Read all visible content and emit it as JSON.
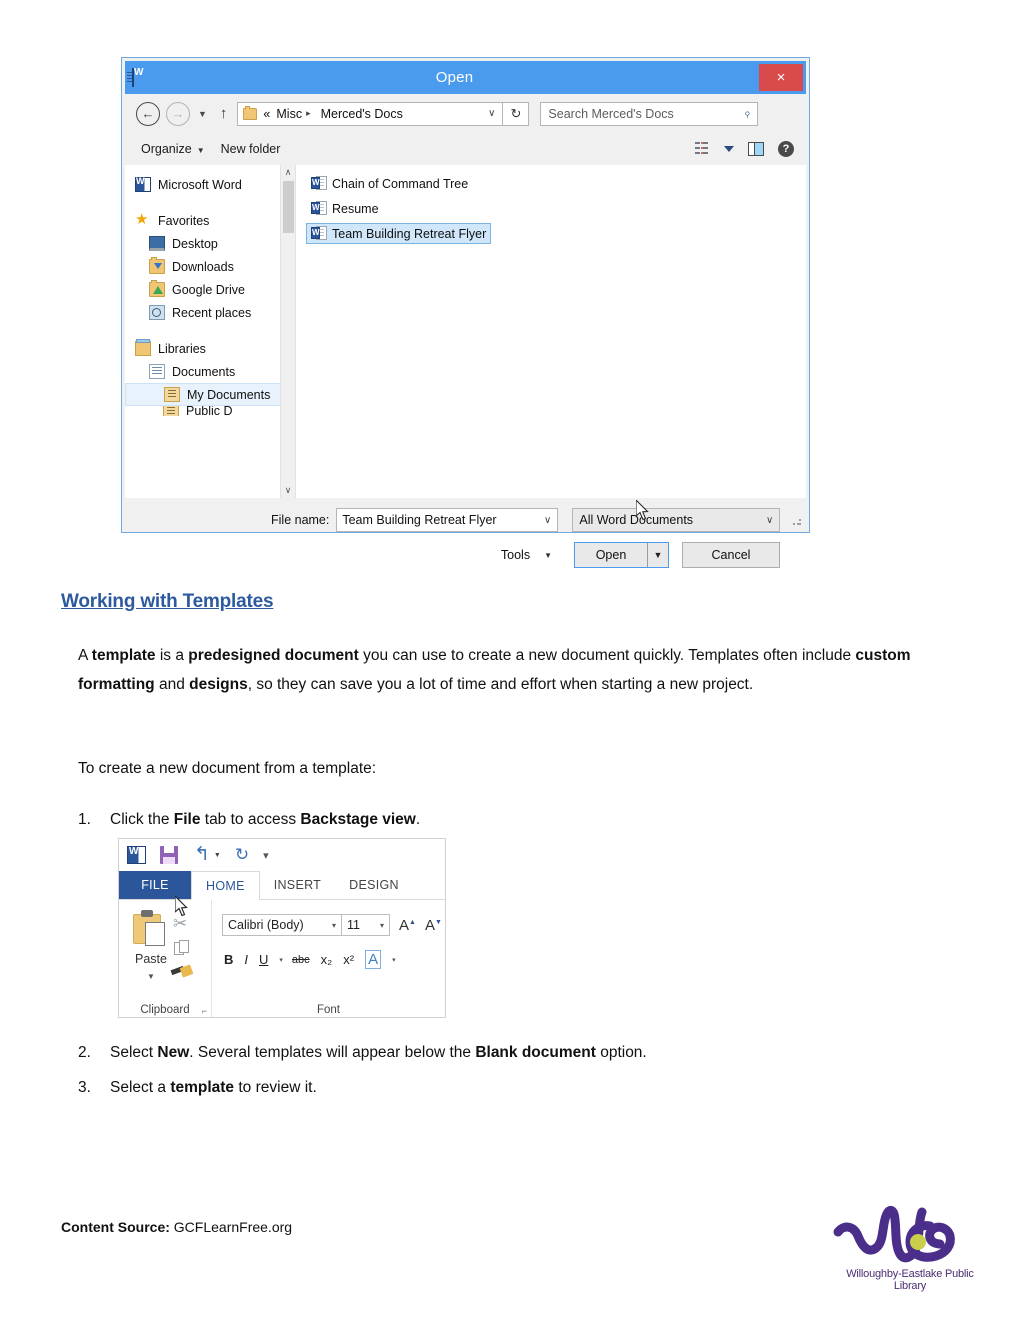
{
  "dialog": {
    "title": "Open",
    "close_label": "×",
    "app_icon": "word-icon",
    "nav": {
      "back": "←",
      "forward": "→",
      "history_caret": "▼",
      "up": "↑",
      "breadcrumb": {
        "prefix": "«",
        "items": [
          "Misc",
          "Merced's Docs"
        ],
        "separator": "▸",
        "caret": "∨"
      },
      "refresh": "↻",
      "search_placeholder": "Search Merced's Docs",
      "search_icon": "search-icon"
    },
    "toolbar": {
      "organize": "Organize",
      "organize_caret": "▼",
      "new_folder": "New folder",
      "view_icon": "view-options-icon",
      "view_caret": "▼",
      "preview_pane_icon": "preview-pane-icon",
      "help_icon": "?"
    },
    "navpane": [
      {
        "label": "Microsoft Word",
        "icon": "word-icon",
        "indent": 0,
        "selected": false,
        "gap_after": true
      },
      {
        "label": "Favorites",
        "icon": "star-icon",
        "indent": 0,
        "selected": false,
        "gap_after": false
      },
      {
        "label": "Desktop",
        "icon": "desktop-icon",
        "indent": 1,
        "selected": false,
        "gap_after": false
      },
      {
        "label": "Downloads",
        "icon": "downloads-folder-icon",
        "indent": 1,
        "selected": false,
        "gap_after": false
      },
      {
        "label": "Google Drive",
        "icon": "google-drive-folder-icon",
        "indent": 1,
        "selected": false,
        "gap_after": false
      },
      {
        "label": "Recent places",
        "icon": "recent-places-icon",
        "indent": 1,
        "selected": false,
        "gap_after": true
      },
      {
        "label": "Libraries",
        "icon": "libraries-icon",
        "indent": 0,
        "selected": false,
        "gap_after": false
      },
      {
        "label": "Documents",
        "icon": "documents-icon",
        "indent": 1,
        "selected": false,
        "gap_after": false
      },
      {
        "label": "My Documents",
        "icon": "my-documents-icon",
        "indent": 2,
        "selected": true,
        "gap_after": false
      }
    ],
    "navpane_cutoff_label": "Public D",
    "files": [
      {
        "name": "Chain of Command Tree",
        "icon": "word-doc-icon",
        "selected": false
      },
      {
        "name": "Resume",
        "icon": "word-doc-icon",
        "selected": false
      },
      {
        "name": "Team Building Retreat Flyer",
        "icon": "word-doc-icon",
        "selected": true
      }
    ],
    "footer": {
      "file_name_label": "File name:",
      "file_name_value": "Team Building Retreat Flyer",
      "file_type_value": "All Word Documents",
      "dropdown_caret": "∨",
      "tools_label": "Tools",
      "tools_caret": "▼",
      "open_label": "Open",
      "open_split_caret": "▼",
      "cancel_label": "Cancel"
    }
  },
  "document": {
    "heading": "Working with Templates",
    "paragraph1": {
      "segments": [
        {
          "text": "A ",
          "bold": false
        },
        {
          "text": "template",
          "bold": true
        },
        {
          "text": " is a ",
          "bold": false
        },
        {
          "text": "predesigned document",
          "bold": true
        },
        {
          "text": " you can use to create a new document  quickly. Templates often include ",
          "bold": false
        },
        {
          "text": "custom formatting",
          "bold": true
        },
        {
          "text": " and ",
          "bold": false
        },
        {
          "text": "designs",
          "bold": true
        },
        {
          "text": ", so they can save you a lot of time and effort when starting a new project.",
          "bold": false
        }
      ]
    },
    "paragraph2": "To create a new document from a template:",
    "steps": [
      {
        "number": "1.",
        "segments": [
          {
            "text": "Click the ",
            "bold": false
          },
          {
            "text": "File",
            "bold": true
          },
          {
            "text": " tab to access ",
            "bold": false
          },
          {
            "text": "Backstage view",
            "bold": true
          },
          {
            "text": ".",
            "bold": false
          }
        ]
      },
      {
        "number": "2.",
        "segments": [
          {
            "text": "Select ",
            "bold": false
          },
          {
            "text": "New",
            "bold": true
          },
          {
            "text": ". Several templates will appear below the ",
            "bold": false
          },
          {
            "text": "Blank document",
            "bold": true
          },
          {
            "text": " option.",
            "bold": false
          }
        ]
      },
      {
        "number": "3.",
        "segments": [
          {
            "text": "Select a ",
            "bold": false
          },
          {
            "text": "template",
            "bold": true
          },
          {
            "text": " to review it.",
            "bold": false
          }
        ]
      }
    ]
  },
  "ribbon": {
    "quick_access": {
      "app_icon": "word-icon",
      "save_icon": "save-icon",
      "undo_icon": "↰",
      "undo_caret": "▼",
      "redo_icon": "↻",
      "more_icon": "▾"
    },
    "tabs": [
      {
        "label": "FILE",
        "state": "file"
      },
      {
        "label": "HOME",
        "state": "active"
      },
      {
        "label": "INSERT",
        "state": "normal"
      },
      {
        "label": "DESIGN",
        "state": "normal"
      }
    ],
    "clipboard": {
      "paste_label": "Paste",
      "paste_caret": "▼",
      "group_label": "Clipboard",
      "cut_icon": "scissors-icon",
      "copy_icon": "copy-icon",
      "format_painter_icon": "format-painter-icon",
      "launcher_icon": "⌐"
    },
    "font": {
      "font_name": "Calibri (Body)",
      "font_size": "11",
      "grow_font": "A",
      "shrink_font": "A",
      "bold": "B",
      "italic": "I",
      "underline": "U",
      "underline_caret": "▾",
      "strikethrough": "abc",
      "subscript": "x₂",
      "superscript": "x²",
      "text_effects": "A",
      "text_effects_caret": "▾",
      "group_label": "Font",
      "caret": "▾"
    }
  },
  "footer": {
    "source_label": "Content Source:",
    "source_value": "GCFLearnFree.org",
    "logo_text": "Willoughby-Eastlake Public Library",
    "logo_mark": "WE",
    "logo_color": "#4a2e8a",
    "logo_dot_color": "#c9cf4a"
  }
}
